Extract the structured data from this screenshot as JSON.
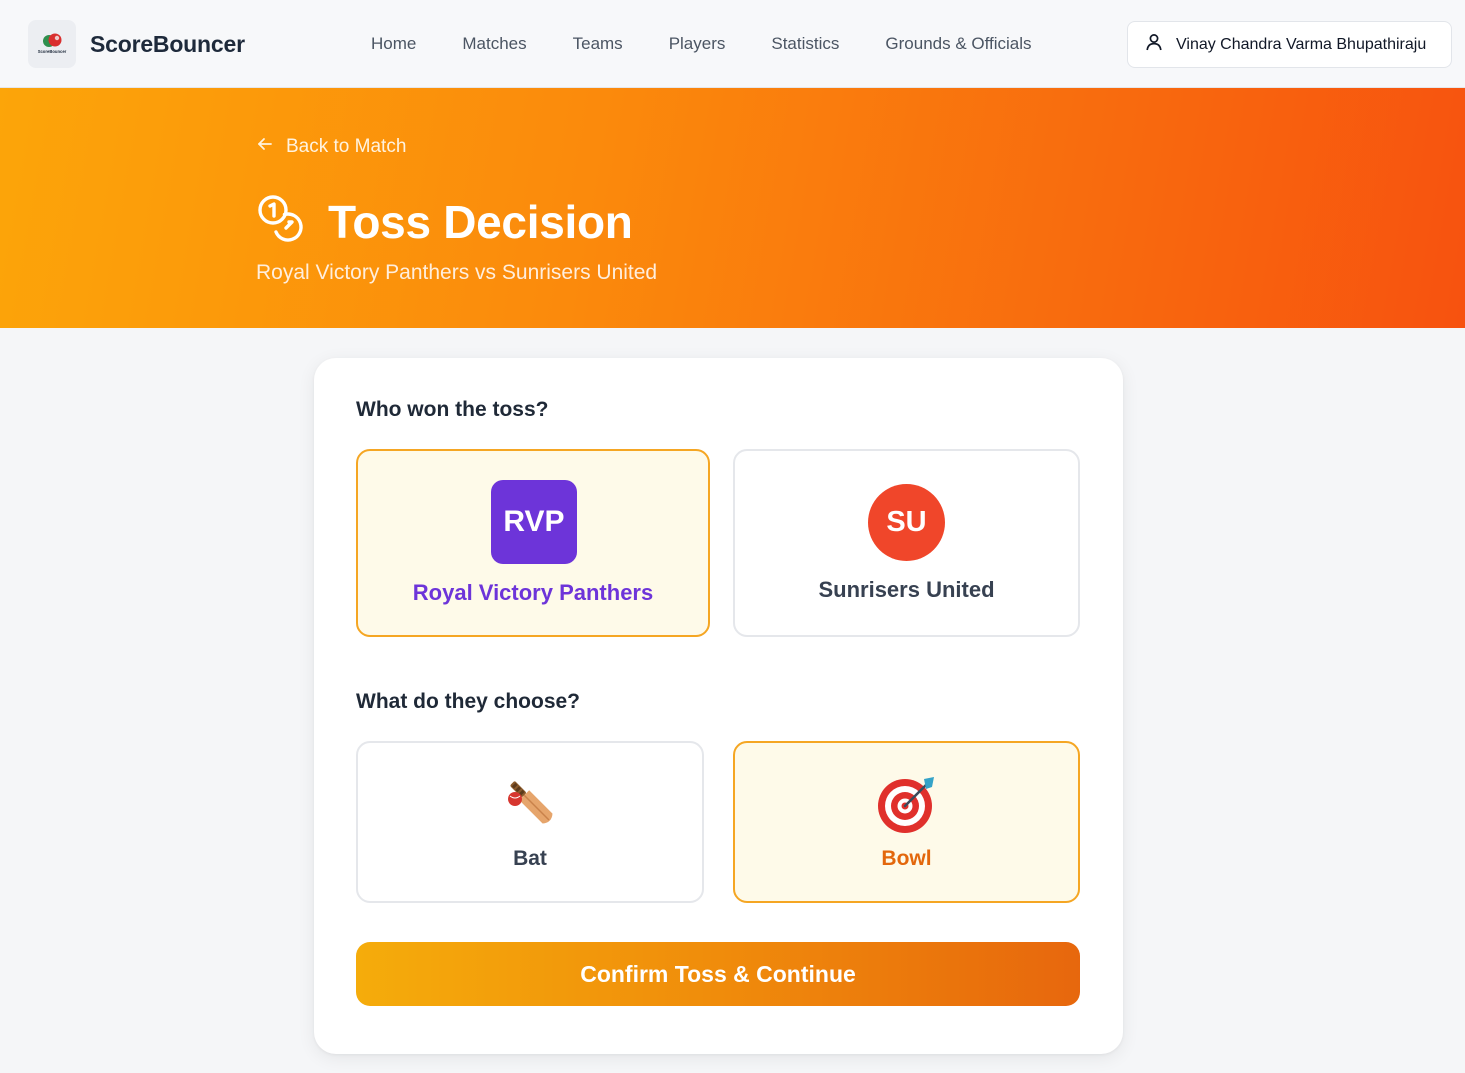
{
  "app": {
    "brand": "ScoreBouncer",
    "logo_small_text": "ScoreBouncer"
  },
  "nav": {
    "items": [
      {
        "label": "Home"
      },
      {
        "label": "Matches"
      },
      {
        "label": "Teams"
      },
      {
        "label": "Players"
      },
      {
        "label": "Statistics"
      },
      {
        "label": "Grounds & Officials"
      }
    ]
  },
  "user": {
    "name": "Vinay Chandra Varma Bhupathiraju",
    "icon": "user-icon"
  },
  "hero": {
    "back_label": "Back to Match",
    "title": "Toss Decision",
    "subtitle": "Royal Victory Panthers vs Sunrisers United",
    "icon": "coins-icon"
  },
  "toss": {
    "question": "Who won the toss?",
    "teams": [
      {
        "short": "RVP",
        "name": "Royal Victory Panthers",
        "color": "#6d34d9",
        "selected": true
      },
      {
        "short": "SU",
        "name": "Sunrisers United",
        "color": "#f0462a",
        "selected": false
      }
    ]
  },
  "choice": {
    "question": "What do they choose?",
    "options": [
      {
        "label": "Bat",
        "icon": "cricket-bat-icon",
        "selected": false
      },
      {
        "label": "Bowl",
        "icon": "target-icon",
        "selected": true
      }
    ]
  },
  "actions": {
    "confirm_label": "Confirm Toss & Continue"
  },
  "colors": {
    "accent": "#f5a623",
    "selected_bg": "#fefae9",
    "rvp_text": "#6d34d9",
    "bowl_text": "#e3670c"
  }
}
